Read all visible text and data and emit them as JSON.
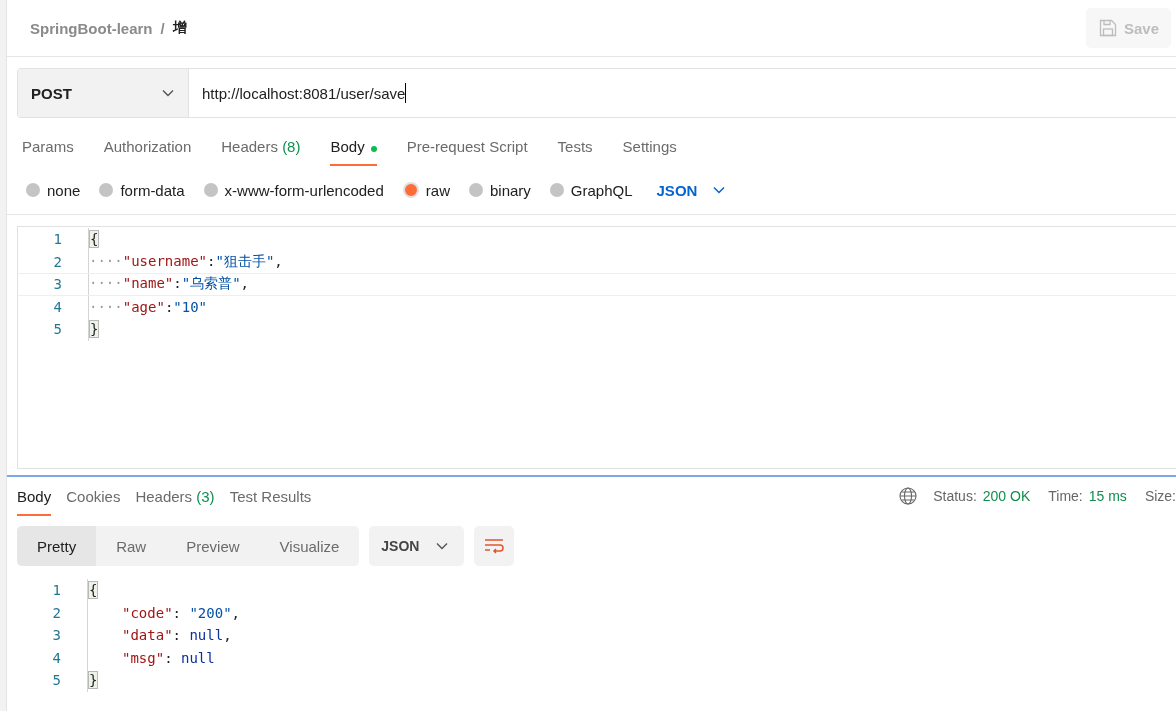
{
  "breadcrumb": {
    "collection": "SpringBoot-learn",
    "separator": "/",
    "request": "增"
  },
  "save_button": {
    "label": "Save",
    "disabled": true
  },
  "request": {
    "method": "POST",
    "url": "http://localhost:8081/user/save"
  },
  "request_tabs": [
    {
      "label": "Params",
      "selected": false
    },
    {
      "label": "Authorization",
      "selected": false
    },
    {
      "label": "Headers",
      "count": "(8)",
      "selected": false
    },
    {
      "label": "Body",
      "selected": true,
      "modified": true
    },
    {
      "label": "Pre-request Script",
      "selected": false
    },
    {
      "label": "Tests",
      "selected": false
    },
    {
      "label": "Settings",
      "selected": false
    }
  ],
  "body_types": [
    {
      "label": "none",
      "selected": false
    },
    {
      "label": "form-data",
      "selected": false
    },
    {
      "label": "x-www-form-urlencoded",
      "selected": false
    },
    {
      "label": "raw",
      "selected": true
    },
    {
      "label": "binary",
      "selected": false
    },
    {
      "label": "GraphQL",
      "selected": false
    }
  ],
  "body_format": "JSON",
  "request_body": {
    "lines": [
      {
        "number": "1",
        "active": false,
        "indented": false,
        "tokens": [
          {
            "kind": "brace",
            "text": "{"
          }
        ]
      },
      {
        "number": "2",
        "active": false,
        "indented": false,
        "tokens": [
          {
            "kind": "ws",
            "text": "····"
          },
          {
            "kind": "key",
            "text": "\"username\""
          },
          {
            "kind": "punct",
            "text": ":"
          },
          {
            "kind": "string",
            "text": "\"狙击手\""
          },
          {
            "kind": "punct",
            "text": ","
          }
        ]
      },
      {
        "number": "3",
        "active": true,
        "indented": false,
        "tokens": [
          {
            "kind": "ws",
            "text": "····"
          },
          {
            "kind": "key",
            "text": "\"name\""
          },
          {
            "kind": "punct",
            "text": ":"
          },
          {
            "kind": "string",
            "text": "\"乌索普\""
          },
          {
            "kind": "punct",
            "text": ","
          }
        ]
      },
      {
        "number": "4",
        "active": false,
        "indented": false,
        "tokens": [
          {
            "kind": "ws",
            "text": "····"
          },
          {
            "kind": "key",
            "text": "\"age\""
          },
          {
            "kind": "punct",
            "text": ":"
          },
          {
            "kind": "string",
            "text": "\"10\""
          }
        ]
      },
      {
        "number": "5",
        "active": false,
        "indented": false,
        "tokens": [
          {
            "kind": "brace",
            "text": "}"
          }
        ]
      }
    ]
  },
  "response_tabs": [
    {
      "label": "Body",
      "selected": true
    },
    {
      "label": "Cookies",
      "selected": false
    },
    {
      "label": "Headers",
      "count": "(3)",
      "selected": false
    },
    {
      "label": "Test Results",
      "selected": false
    }
  ],
  "response_status": {
    "status_label": "Status:",
    "status": "200 OK",
    "time_label": "Time:",
    "time": "15 ms",
    "size_label": "Size:"
  },
  "view_modes": [
    {
      "label": "Pretty",
      "selected": true
    },
    {
      "label": "Raw",
      "selected": false
    },
    {
      "label": "Preview",
      "selected": false
    },
    {
      "label": "Visualize",
      "selected": false
    }
  ],
  "response_format": "JSON",
  "response_body": {
    "lines": [
      {
        "number": "1",
        "active": false,
        "indented": false,
        "tokens": [
          {
            "kind": "brace",
            "text": "{"
          }
        ]
      },
      {
        "number": "2",
        "active": false,
        "indented": true,
        "tokens": [
          {
            "kind": "key",
            "text": "\"code\""
          },
          {
            "kind": "punct",
            "text": ": "
          },
          {
            "kind": "string",
            "text": "\"200\""
          },
          {
            "kind": "punct",
            "text": ","
          }
        ]
      },
      {
        "number": "3",
        "active": false,
        "indented": true,
        "tokens": [
          {
            "kind": "key",
            "text": "\"data\""
          },
          {
            "kind": "punct",
            "text": ": "
          },
          {
            "kind": "keyword",
            "text": "null"
          },
          {
            "kind": "punct",
            "text": ","
          }
        ]
      },
      {
        "number": "4",
        "active": false,
        "indented": true,
        "tokens": [
          {
            "kind": "key",
            "text": "\"msg\""
          },
          {
            "kind": "punct",
            "text": ": "
          },
          {
            "kind": "keyword",
            "text": "null"
          }
        ]
      },
      {
        "number": "5",
        "active": false,
        "indented": false,
        "tokens": [
          {
            "kind": "brace",
            "text": "}"
          }
        ]
      }
    ]
  }
}
